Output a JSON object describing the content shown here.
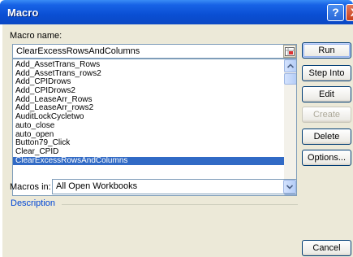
{
  "window": {
    "title": "Macro",
    "help_glyph": "?",
    "close_glyph": "X"
  },
  "macro_name": {
    "label": "Macro name:",
    "value": "ClearExcessRowsAndColumns"
  },
  "macro_list": {
    "items": [
      "Add_AssetTrans_Rows",
      "Add_AssetTrans_rows2",
      "Add_CPIDrows",
      "Add_CPIDrows2",
      "Add_LeaseArr_Rows",
      "Add_LeaseArr_rows2",
      "AuditLockCycletwo",
      "auto_close",
      "auto_open",
      "Button79_Click",
      "Clear_CPID",
      "ClearExcessRowsAndColumns"
    ],
    "selected_index": 11
  },
  "buttons": {
    "run": "Run",
    "step_into": "Step Into",
    "edit": "Edit",
    "create": "Create",
    "delete": "Delete",
    "options": "Options...",
    "cancel": "Cancel"
  },
  "macros_in": {
    "label": "Macros in:",
    "value": "All Open Workbooks"
  },
  "description": {
    "label": "Description"
  },
  "icons": {
    "picker": "range-picker-icon",
    "scroll_up": "chevron-up-icon",
    "scroll_down": "chevron-down-icon",
    "dropdown": "chevron-down-icon"
  }
}
